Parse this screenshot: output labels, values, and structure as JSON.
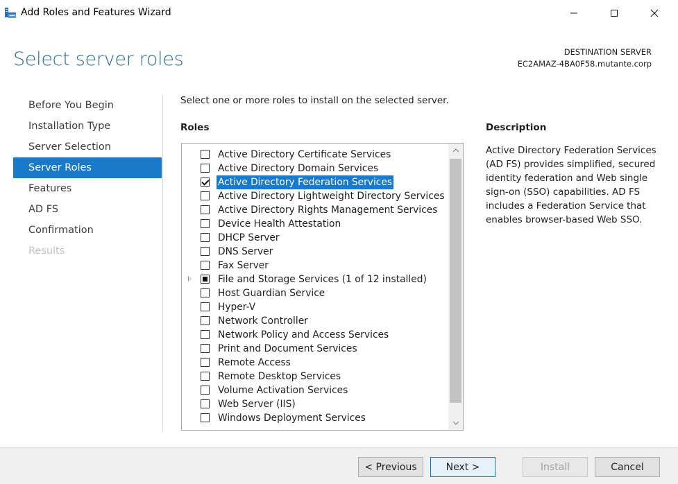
{
  "window": {
    "title": "Add Roles and Features Wizard",
    "icon": "server-manager-icon",
    "controls": [
      "minimize-icon",
      "maximize-icon",
      "close-icon"
    ]
  },
  "header": {
    "page_title": "Select server roles",
    "destination_label": "DESTINATION SERVER",
    "destination_server": "EC2AMAZ-4BA0F58.mutante.corp"
  },
  "nav": {
    "items": [
      {
        "label": "Before You Begin",
        "state": "normal"
      },
      {
        "label": "Installation Type",
        "state": "normal"
      },
      {
        "label": "Server Selection",
        "state": "normal"
      },
      {
        "label": "Server Roles",
        "state": "active"
      },
      {
        "label": "Features",
        "state": "normal"
      },
      {
        "label": "AD FS",
        "state": "normal"
      },
      {
        "label": "Confirmation",
        "state": "normal"
      },
      {
        "label": "Results",
        "state": "disabled"
      }
    ]
  },
  "main": {
    "instruction": "Select one or more roles to install on the selected server.",
    "roles_heading": "Roles",
    "roles": [
      {
        "label": "Active Directory Certificate Services",
        "state": "unchecked"
      },
      {
        "label": "Active Directory Domain Services",
        "state": "unchecked"
      },
      {
        "label": "Active Directory Federation Services",
        "state": "checked",
        "selected": true
      },
      {
        "label": "Active Directory Lightweight Directory Services",
        "state": "unchecked"
      },
      {
        "label": "Active Directory Rights Management Services",
        "state": "unchecked"
      },
      {
        "label": "Device Health Attestation",
        "state": "unchecked"
      },
      {
        "label": "DHCP Server",
        "state": "unchecked"
      },
      {
        "label": "DNS Server",
        "state": "unchecked"
      },
      {
        "label": "Fax Server",
        "state": "unchecked"
      },
      {
        "label": "File and Storage Services (1 of 12 installed)",
        "state": "partial",
        "expandable": true
      },
      {
        "label": "Host Guardian Service",
        "state": "unchecked"
      },
      {
        "label": "Hyper-V",
        "state": "unchecked"
      },
      {
        "label": "Network Controller",
        "state": "unchecked"
      },
      {
        "label": "Network Policy and Access Services",
        "state": "unchecked"
      },
      {
        "label": "Print and Document Services",
        "state": "unchecked"
      },
      {
        "label": "Remote Access",
        "state": "unchecked"
      },
      {
        "label": "Remote Desktop Services",
        "state": "unchecked"
      },
      {
        "label": "Volume Activation Services",
        "state": "unchecked"
      },
      {
        "label": "Web Server (IIS)",
        "state": "unchecked"
      },
      {
        "label": "Windows Deployment Services",
        "state": "unchecked"
      }
    ],
    "description_heading": "Description",
    "description": "Active Directory Federation Services (AD FS) provides simplified, secured identity federation and Web single sign-on (SSO) capabilities. AD FS includes a Federation Service that enables browser-based Web SSO."
  },
  "footer": {
    "previous_label": "< Previous",
    "next_label": "Next >",
    "install_label": "Install",
    "install_enabled": false,
    "cancel_label": "Cancel"
  },
  "colors": {
    "accent": "#1979ca",
    "title": "#2a6b8f",
    "footer_bg": "#f0f0f0"
  }
}
